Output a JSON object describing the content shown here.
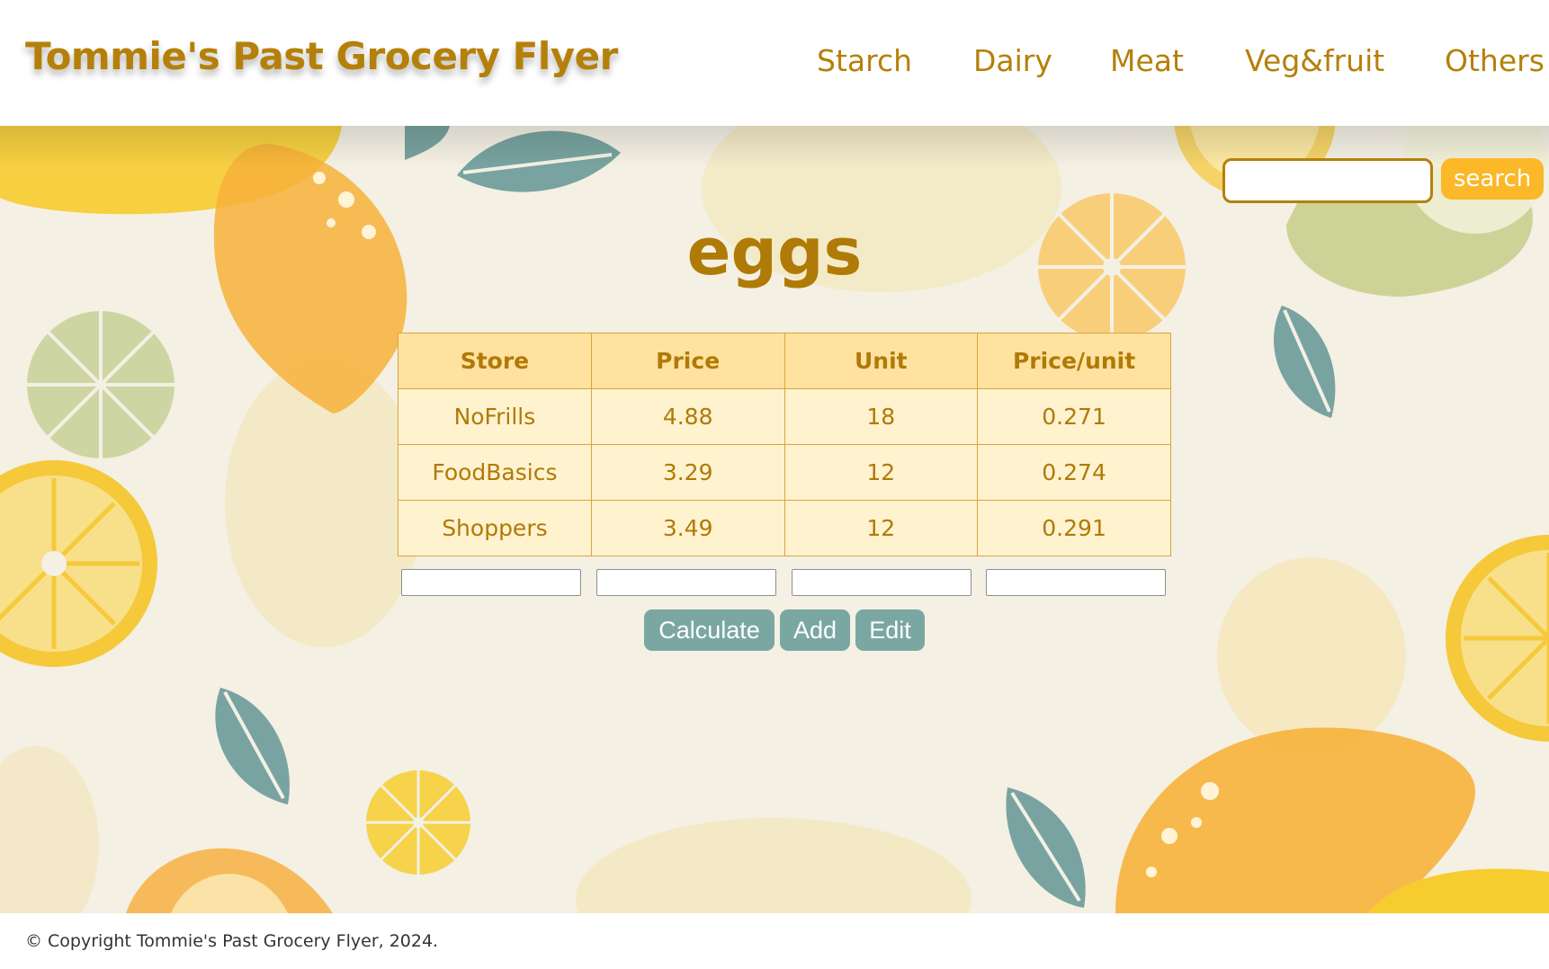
{
  "header": {
    "title": "Tommie's Past Grocery Flyer",
    "nav": [
      "Starch",
      "Dairy",
      "Meat",
      "Veg&fruit",
      "Others"
    ]
  },
  "search": {
    "value": "",
    "placeholder": "",
    "button_label": "search"
  },
  "main": {
    "heading": "eggs",
    "table": {
      "columns": [
        "Store",
        "Price",
        "Unit",
        "Price/unit"
      ],
      "rows": [
        [
          "NoFrills",
          "4.88",
          "18",
          "0.271"
        ],
        [
          "FoodBasics",
          "3.29",
          "12",
          "0.274"
        ],
        [
          "Shoppers",
          "3.49",
          "12",
          "0.291"
        ]
      ]
    },
    "entry_fields": [
      "",
      "",
      "",
      ""
    ],
    "buttons": {
      "calculate": "Calculate",
      "add": "Add",
      "edit": "Edit"
    }
  },
  "footer": {
    "copyright": "© Copyright Tommie's Past Grocery Flyer, 2024."
  },
  "colors": {
    "accent": "#b5800a",
    "search_button": "#fbb829",
    "action_button": "#7ba7a2",
    "table_header": "#ffe2a0",
    "table_cell": "#fff2cf",
    "background": "#f4f0e4"
  },
  "icons": [
    "lemon-illustration",
    "lemon-slice-illustration",
    "leaf-illustration"
  ]
}
